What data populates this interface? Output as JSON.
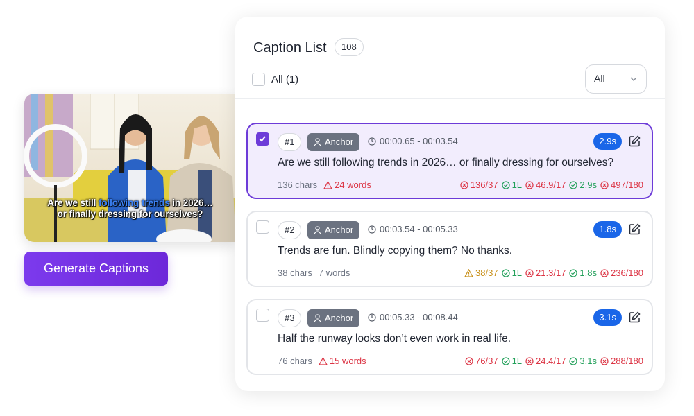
{
  "preview": {
    "caption_line1_pre": "Are we still ",
    "caption_line1_hl": "following trends",
    "caption_line1_post": " in 2026…",
    "caption_line2": "or finally dressing for ourselves?"
  },
  "generate_button": "Generate Captions",
  "panel": {
    "title": "Caption List",
    "count": "108",
    "select_all_label": "All (1)",
    "filter_value": "All"
  },
  "captions": [
    {
      "number": "#1",
      "speaker": "Anchor",
      "time": "00:00.65 - 00:03.54",
      "duration": "2.9s",
      "text": "Are we still following trends in 2026… or finally dressing for ourselves?",
      "chars": "136 chars",
      "words": "24 words",
      "words_warning": true,
      "selected": true,
      "stats": [
        {
          "status": "error",
          "value": "136/37"
        },
        {
          "status": "ok",
          "value": "1L"
        },
        {
          "status": "error",
          "value": "46.9/17"
        },
        {
          "status": "ok",
          "value": "2.9s"
        },
        {
          "status": "error",
          "value": "497/180"
        }
      ]
    },
    {
      "number": "#2",
      "speaker": "Anchor",
      "time": "00:03.54 - 00:05.33",
      "duration": "1.8s",
      "text": "Trends are fun. Blindly copying them? No thanks.",
      "chars": "38 chars",
      "words": "7 words",
      "words_warning": false,
      "selected": false,
      "stats": [
        {
          "status": "warning",
          "value": "38/37"
        },
        {
          "status": "ok",
          "value": "1L"
        },
        {
          "status": "error",
          "value": "21.3/17"
        },
        {
          "status": "ok",
          "value": "1.8s"
        },
        {
          "status": "error",
          "value": "236/180"
        }
      ]
    },
    {
      "number": "#3",
      "speaker": "Anchor",
      "time": "00:05.33 - 00:08.44",
      "duration": "3.1s",
      "text": "Half the runway looks don’t even work in real life.",
      "chars": "76 chars",
      "words": "15 words",
      "words_warning": true,
      "selected": false,
      "stats": [
        {
          "status": "error",
          "value": "76/37"
        },
        {
          "status": "ok",
          "value": "1L"
        },
        {
          "status": "error",
          "value": "24.4/17"
        },
        {
          "status": "ok",
          "value": "3.1s"
        },
        {
          "status": "error",
          "value": "288/180"
        }
      ]
    }
  ],
  "colors": {
    "accent": "#6d3bd8",
    "duration_badge": "#1a66e8",
    "error": "#dc3545",
    "ok": "#22a05a",
    "warning": "#c8901a",
    "speaker_tag": "#6b7280"
  }
}
